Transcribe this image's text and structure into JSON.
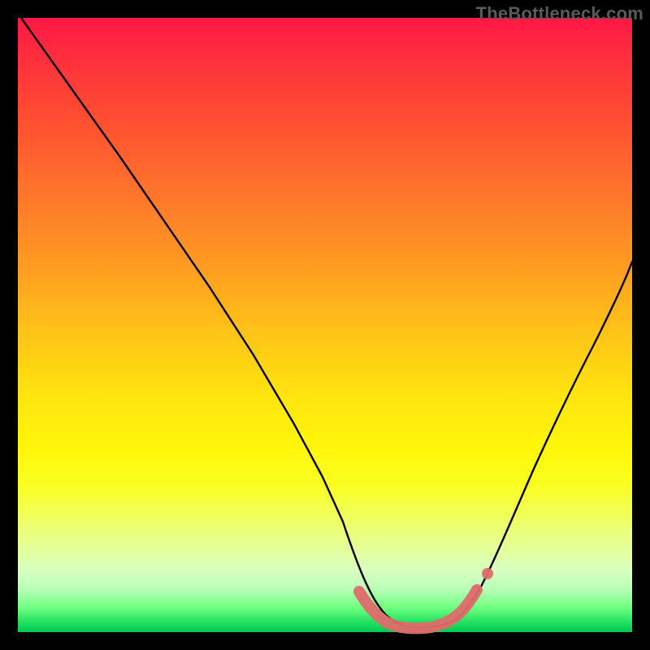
{
  "watermark": "TheBottleneck.com",
  "chart_data": {
    "type": "line",
    "title": "",
    "xlabel": "",
    "ylabel": "",
    "xlim": [
      0,
      100
    ],
    "ylim": [
      0,
      100
    ],
    "grid": false,
    "legend": false,
    "series": [
      {
        "name": "bottleneck-curve",
        "color": "#000000",
        "x": [
          0,
          5,
          10,
          15,
          20,
          25,
          30,
          35,
          40,
          45,
          50,
          52,
          55,
          58,
          60,
          63,
          65,
          70,
          75,
          80,
          85,
          90,
          95,
          100
        ],
        "y": [
          100,
          92,
          84,
          75,
          67,
          58,
          50,
          42,
          33,
          24,
          15,
          10,
          6,
          3,
          1.5,
          1,
          1,
          1.2,
          3,
          10,
          22,
          37,
          52,
          63
        ]
      },
      {
        "name": "optimal-band",
        "color": "#e57373",
        "type": "highlight",
        "x": [
          53,
          55,
          58,
          60,
          63,
          65,
          68,
          70,
          72
        ],
        "y": [
          5.5,
          4,
          2.5,
          1.8,
          1.3,
          1.4,
          1.8,
          2.6,
          4.2
        ]
      }
    ],
    "annotations": []
  }
}
